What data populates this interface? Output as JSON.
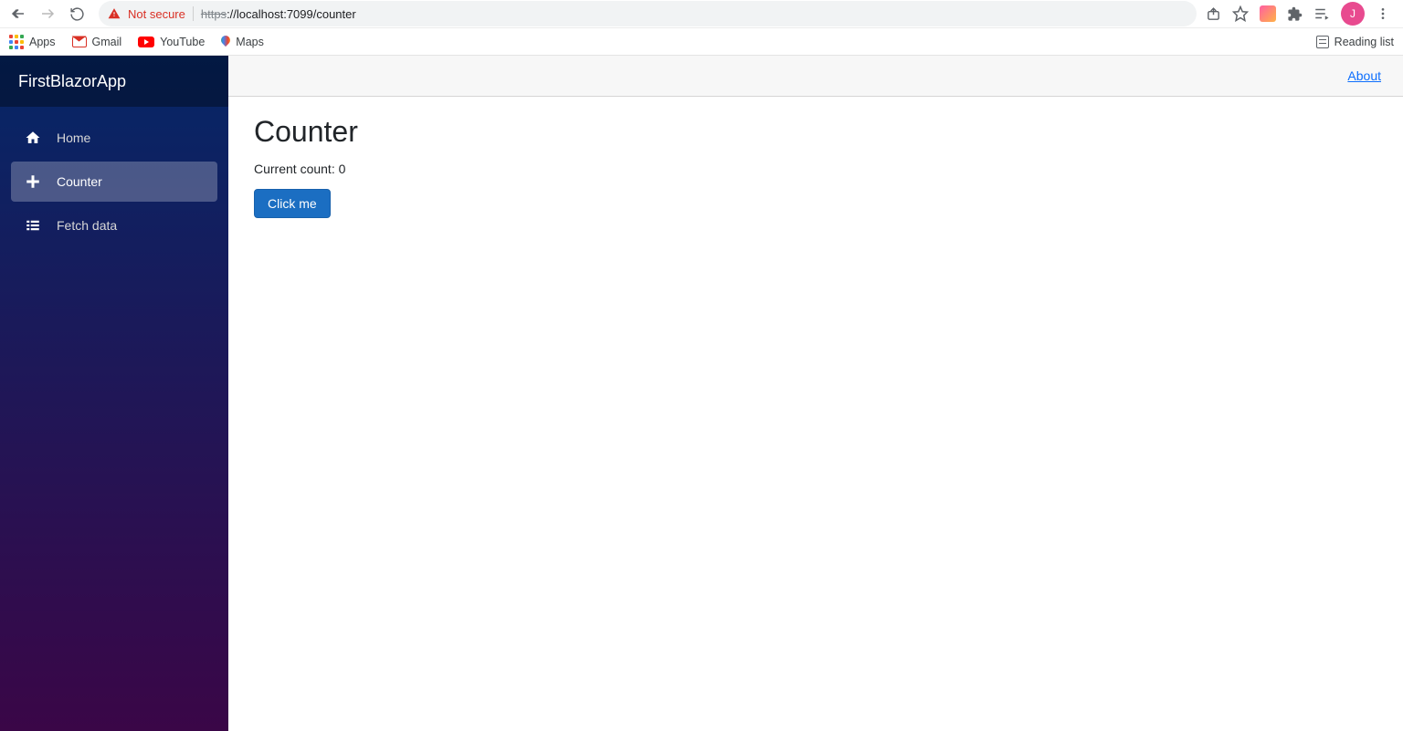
{
  "browser": {
    "not_secure": "Not secure",
    "url_https": "https",
    "url_rest": "://localhost:7099/counter",
    "avatar_initial": "J",
    "bookmarks": {
      "apps": "Apps",
      "gmail": "Gmail",
      "youtube": "YouTube",
      "maps": "Maps",
      "reading_list": "Reading list"
    }
  },
  "app": {
    "brand": "FirstBlazorApp",
    "nav": {
      "home": "Home",
      "counter": "Counter",
      "fetch": "Fetch data"
    },
    "top_row": {
      "about": "About"
    },
    "page": {
      "title": "Counter",
      "count_label_with_value": "Current count: 0",
      "count_value": 0,
      "button": "Click me"
    }
  }
}
